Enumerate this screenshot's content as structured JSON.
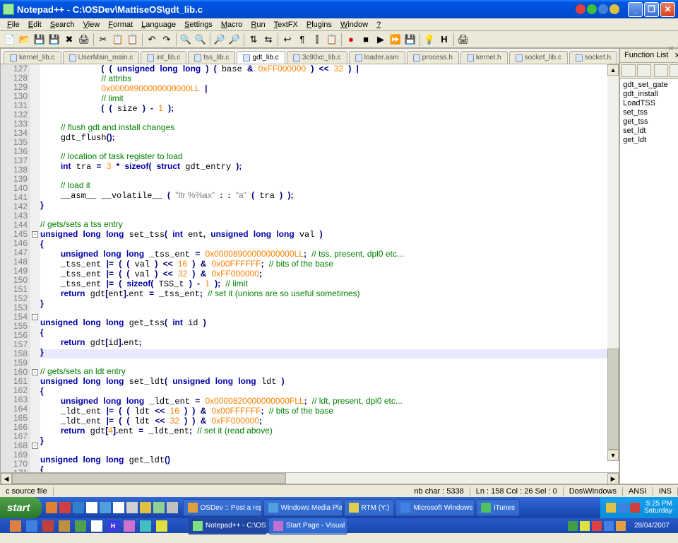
{
  "titlebar": {
    "text": "Notepad++ - C:\\OSDev\\MattiseOS\\gdt_lib.c"
  },
  "menu": [
    "File",
    "Edit",
    "Search",
    "View",
    "Format",
    "Language",
    "Settings",
    "Macro",
    "Run",
    "TextFX",
    "Plugins",
    "Window",
    "?"
  ],
  "tabs": [
    {
      "label": "kernel_lib.c",
      "active": false
    },
    {
      "label": "UserMain_main.c",
      "active": false
    },
    {
      "label": "int_lib.c",
      "active": false
    },
    {
      "label": "tss_lib.c",
      "active": false
    },
    {
      "label": "gdt_lib.c",
      "active": true
    },
    {
      "label": "3c90xc_lib.c",
      "active": false
    },
    {
      "label": "loader.asm",
      "active": false
    },
    {
      "label": "process.h",
      "active": false
    },
    {
      "label": "kernel.h",
      "active": false
    },
    {
      "label": "socket_lib.c",
      "active": false
    },
    {
      "label": "socket.h",
      "active": false
    }
  ],
  "function_panel": {
    "title": "Function List",
    "items": [
      "gdt_set_gate",
      "gdt_install",
      "LoadTSS",
      "set_tss",
      "get_tss",
      "set_ldt",
      "get_ldt"
    ]
  },
  "line_start": 127,
  "line_end": 171,
  "highlighted_line": 158,
  "status": {
    "left": "c source file",
    "nbchar": "nb char : 5338",
    "pos": "Ln : 158    Col : 26    Sel : 0",
    "eol": "Dos\\Windows",
    "enc": "ANSI",
    "ins": "INS"
  },
  "taskbar": {
    "start": "start",
    "tasks": [
      {
        "label": "OSDev :: Post a reply",
        "color": "#e0a040"
      },
      {
        "label": "Windows Media Player",
        "color": "#50a0e0"
      },
      {
        "label": "RTM (Y:)",
        "color": "#e0d050"
      },
      {
        "label": "Microsoft Windows Dr...",
        "color": "#4080e0"
      },
      {
        "label": "iTunes",
        "color": "#50c060"
      }
    ],
    "tasks2": [
      {
        "label": "Notepad++ - C:\\OSD...",
        "color": "#80e080"
      },
      {
        "label": "Start Page - Visual C...",
        "color": "#c070d0"
      }
    ],
    "time": "5:25 PM",
    "day": "Saturday",
    "date": "28/04/2007"
  }
}
